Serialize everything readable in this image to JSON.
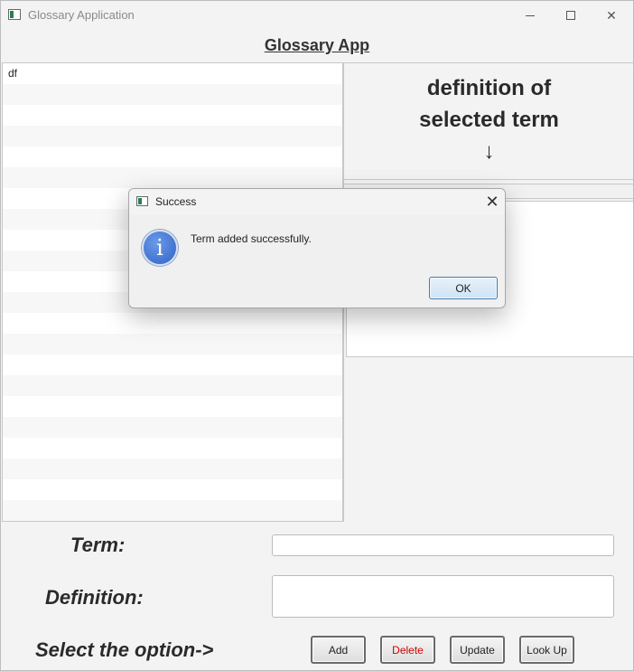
{
  "window": {
    "title": "Glossary Application"
  },
  "header": {
    "title": "Glossary App"
  },
  "list": {
    "items": [
      "df"
    ],
    "row_count": 22
  },
  "definition_panel": {
    "heading_line1": "definition of",
    "heading_line2": "selected term",
    "arrow": "↓"
  },
  "form": {
    "term_label": "Term:",
    "definition_label": "Definition:",
    "option_label": "Select the option->",
    "term_value": "",
    "definition_value": ""
  },
  "buttons": {
    "add": "Add",
    "delete": "Delete",
    "update": "Update",
    "lookup": "Look Up"
  },
  "dialog": {
    "title": "Success",
    "message": "Term added successfully.",
    "ok_label": "OK",
    "icon": "info-icon",
    "icon_glyph": "i"
  }
}
